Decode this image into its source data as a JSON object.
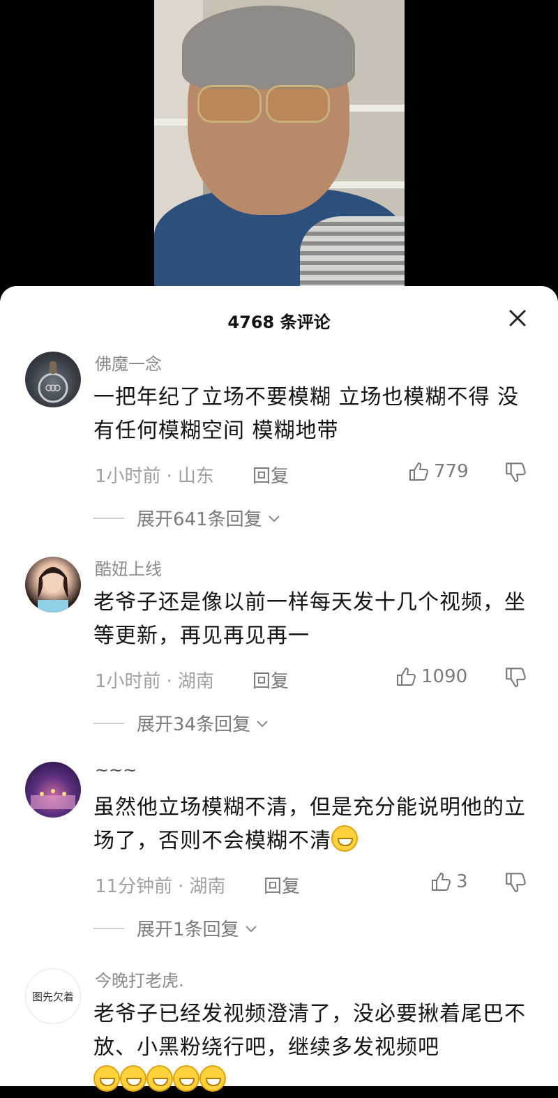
{
  "header": {
    "title": "4768 条评论"
  },
  "avatar4_text": "图先欠着",
  "comments": [
    {
      "username": "佛魔一念",
      "text": "一把年纪了立场不要模糊  立场也模糊不得 没有任何模糊空间 模糊地带",
      "time": "1小时前",
      "location": "山东",
      "reply": "回复",
      "likes": "779",
      "expand": "展开641条回复"
    },
    {
      "username": "酷妞上线",
      "text": "老爷子还是像以前一样每天发十几个视频，坐等更新，再见再见再一",
      "time": "1小时前",
      "location": "湖南",
      "reply": "回复",
      "likes": "1090",
      "expand": "展开34条回复"
    },
    {
      "username": "~~~",
      "text": "虽然他立场模糊不清，但是充分能说明他的立场了，否则不会模糊不清",
      "time": "11分钟前",
      "location": "湖南",
      "reply": "回复",
      "likes": "3",
      "expand": "展开1条回复"
    },
    {
      "username": "今晚打老虎.",
      "text": "老爷子已经发视频澄清了，没必要揪着尾巴不放、小黑粉绕行吧，继续多发视频吧"
    }
  ]
}
